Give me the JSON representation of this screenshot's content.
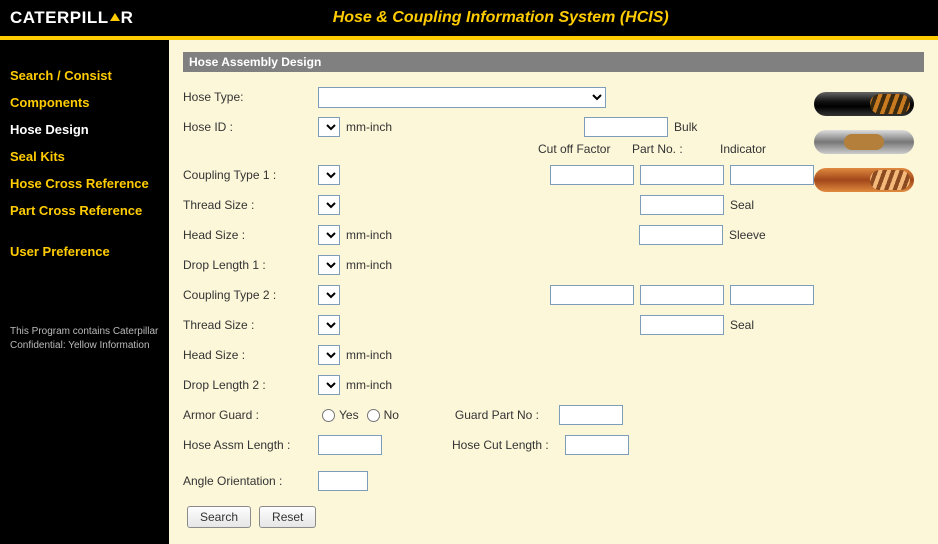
{
  "header": {
    "logo_left": "CATERPILL",
    "logo_right": "R",
    "app_title": "Hose & Coupling Information System (HCIS)"
  },
  "sidebar": {
    "items": [
      {
        "label": "Search / Consist",
        "active": false
      },
      {
        "label": "Components",
        "active": false
      },
      {
        "label": "Hose Design",
        "active": true
      },
      {
        "label": "Seal Kits",
        "active": false
      },
      {
        "label": "Hose Cross Reference",
        "active": false
      },
      {
        "label": "Part Cross Reference",
        "active": false
      }
    ],
    "user_pref": "User Preference",
    "confidential": "This Program contains Caterpillar Confidential: Yellow Information"
  },
  "panel": {
    "title": "Hose Assembly Design",
    "labels": {
      "hose_type": "Hose Type:",
      "hose_id": "Hose ID :",
      "mm_inch": "mm-inch",
      "bulk": "Bulk",
      "cut_off_factor": "Cut off Factor",
      "part_no": "Part No. :",
      "indicator": "Indicator",
      "coupling_type_1": "Coupling Type 1 :",
      "thread_size": "Thread Size :",
      "seal": "Seal",
      "head_size": "Head Size :",
      "sleeve": "Sleeve",
      "drop_length_1": "Drop Length 1 :",
      "coupling_type_2": "Coupling Type 2 :",
      "drop_length_2": "Drop Length 2 :",
      "armor_guard": "Armor Guard :",
      "yes": "Yes",
      "no": "No",
      "guard_part_no": "Guard Part No :",
      "hose_assm_length": "Hose Assm Length :",
      "hose_cut_length": "Hose Cut Length :",
      "angle_orientation": "Angle Orientation :"
    },
    "buttons": {
      "search": "Search",
      "reset": "Reset"
    }
  }
}
